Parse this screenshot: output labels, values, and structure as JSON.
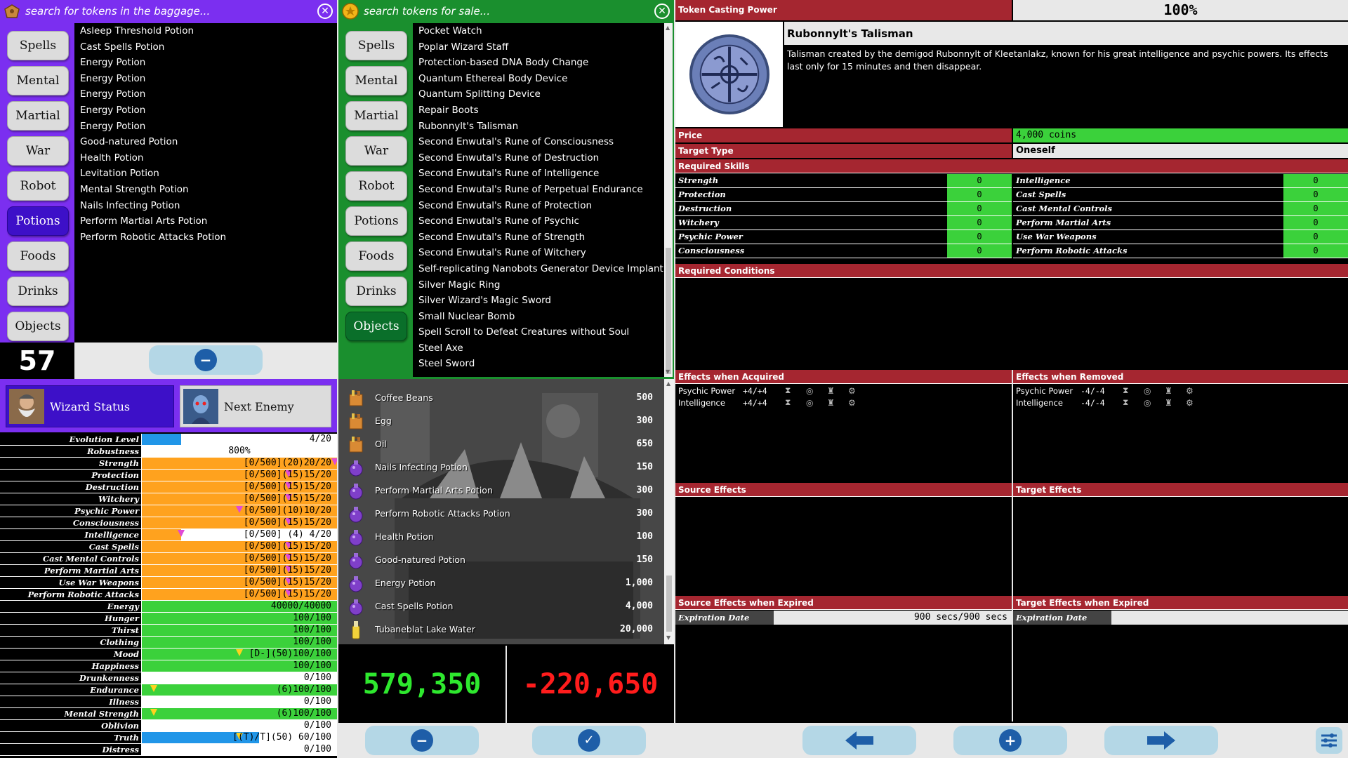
{
  "baggage": {
    "search_placeholder": "search for tokens in the baggage...",
    "categories": [
      "Spells",
      "Mental",
      "Martial",
      "War",
      "Robot",
      "Potions",
      "Foods",
      "Drinks",
      "Objects"
    ],
    "selected_category": "Potions",
    "items": [
      "Asleep Threshold Potion",
      "Cast Spells Potion",
      "Energy Potion",
      "Energy Potion",
      "Energy Potion",
      "Energy Potion",
      "Energy Potion",
      "Good-natured Potion",
      "Health Potion",
      "Levitation Potion",
      "Mental Strength Potion",
      "Nails Infecting Potion",
      "Perform Martial Arts Potion",
      "Perform Robotic Attacks Potion"
    ],
    "count": "57"
  },
  "shop": {
    "search_placeholder": "search tokens for sale...",
    "categories": [
      "Spells",
      "Mental",
      "Martial",
      "War",
      "Robot",
      "Potions",
      "Foods",
      "Drinks",
      "Objects"
    ],
    "selected_category": "Objects",
    "items": [
      "Pocket Watch",
      "Poplar Wizard Staff",
      "Protection-based DNA Body Change",
      "Quantum Ethereal Body Device",
      "Quantum Splitting Device",
      "Repair Boots",
      "Rubonnylt's Talisman",
      "Second Enwutal's Rune of Consciousness",
      "Second Enwutal's Rune of Destruction",
      "Second Enwutal's Rune of Intelligence",
      "Second Enwutal's Rune of Perpetual Endurance",
      "Second Enwutal's Rune of Protection",
      "Second Enwutal's Rune of Psychic",
      "Second Enwutal's Rune of Strength",
      "Second Enwutal's Rune of Witchery",
      "Self-replicating Nanobots Generator Device Implant",
      "Silver Magic Ring",
      "Silver Wizard's Magic Sword",
      "Small Nuclear Bomb",
      "Spell Scroll to Defeat Creatures without Soul",
      "Steel Axe",
      "Steel Sword"
    ]
  },
  "tabs": {
    "wizard": "Wizard Status",
    "enemy": "Next Enemy"
  },
  "stats": [
    {
      "label": "Evolution Level",
      "value": "4/20",
      "color": "#2196e8",
      "fill": 0.2,
      "style": "val"
    },
    {
      "label": "Robustness",
      "value": "800%",
      "color": "#ffffff",
      "fill": 0,
      "style": "mid"
    },
    {
      "label": "Strength",
      "value": "[0/500](20)20/20",
      "color": "#ffa21e",
      "fill": 1.0,
      "style": "val",
      "mark": 0.99
    },
    {
      "label": "Protection",
      "value": "[0/500](15)15/20",
      "color": "#ffa21e",
      "fill": 1.0,
      "style": "val",
      "mark": 0.75
    },
    {
      "label": "Destruction",
      "value": "[0/500](15)15/20",
      "color": "#ffa21e",
      "fill": 1.0,
      "style": "val",
      "mark": 0.75
    },
    {
      "label": "Witchery",
      "value": "[0/500](15)15/20",
      "color": "#ffa21e",
      "fill": 1.0,
      "style": "val",
      "mark": 0.75
    },
    {
      "label": "Psychic Power",
      "value": "[0/500](10)10/20",
      "color": "#ffa21e",
      "fill": 1.0,
      "style": "val",
      "mark": 0.5
    },
    {
      "label": "Consciousness",
      "value": "[0/500](15)15/20",
      "color": "#ffa21e",
      "fill": 1.0,
      "style": "val",
      "mark": 0.75
    },
    {
      "label": "Intelligence",
      "value": "[0/500] (4) 4/20",
      "color": "#ffa21e",
      "fill": 0.2,
      "style": "val",
      "mark": 0.2
    },
    {
      "label": "Cast Spells",
      "value": "[0/500](15)15/20",
      "color": "#ffa21e",
      "fill": 1.0,
      "style": "val",
      "mark": 0.75
    },
    {
      "label": "Cast Mental Controls",
      "value": "[0/500](15)15/20",
      "color": "#ffa21e",
      "fill": 1.0,
      "style": "val",
      "mark": 0.75
    },
    {
      "label": "Perform Martial Arts",
      "value": "[0/500](15)15/20",
      "color": "#ffa21e",
      "fill": 1.0,
      "style": "val",
      "mark": 0.75
    },
    {
      "label": "Use War Weapons",
      "value": "[0/500](15)15/20",
      "color": "#ffa21e",
      "fill": 1.0,
      "style": "val",
      "mark": 0.75
    },
    {
      "label": "Perform Robotic Attacks",
      "value": "[0/500](15)15/20",
      "color": "#ffa21e",
      "fill": 1.0,
      "style": "val",
      "mark": 0.75
    },
    {
      "label": "Energy",
      "value": "40000/40000",
      "color": "#3bd13b",
      "fill": 1.0,
      "style": "val"
    },
    {
      "label": "Hunger",
      "value": "100/100",
      "color": "#3bd13b",
      "fill": 1.0,
      "style": "val"
    },
    {
      "label": "Thirst",
      "value": "100/100",
      "color": "#3bd13b",
      "fill": 1.0,
      "style": "val"
    },
    {
      "label": "Clothing",
      "value": "100/100",
      "color": "#3bd13b",
      "fill": 1.0,
      "style": "val"
    },
    {
      "label": "Mood",
      "value": "[D-](50)100/100",
      "color": "#3bd13b",
      "fill": 1.0,
      "style": "val",
      "ymark": 0.5
    },
    {
      "label": "Happiness",
      "value": "100/100",
      "color": "#3bd13b",
      "fill": 1.0,
      "style": "val"
    },
    {
      "label": "Drunkenness",
      "value": "0/100",
      "color": "#ffffff",
      "fill": 0,
      "style": "val"
    },
    {
      "label": "Endurance",
      "value": "(6)100/100",
      "color": "#3bd13b",
      "fill": 1.0,
      "style": "val",
      "ymark": 0.06
    },
    {
      "label": "Illness",
      "value": "0/100",
      "color": "#ffffff",
      "fill": 0,
      "style": "val"
    },
    {
      "label": "Mental Strength",
      "value": "(6)100/100",
      "color": "#3bd13b",
      "fill": 1.0,
      "style": "val",
      "ymark": 0.06
    },
    {
      "label": "Oblivion",
      "value": "0/100",
      "color": "#ffffff",
      "fill": 0,
      "style": "val"
    },
    {
      "label": "Truth",
      "value": "[(T)/T](50) 60/100",
      "color": "#2196e8",
      "fill": 0.6,
      "style": "val",
      "ymark": 0.5
    },
    {
      "label": "Distress",
      "value": "0/100",
      "color": "#ffffff",
      "fill": 0,
      "style": "val"
    }
  ],
  "sale_list": [
    {
      "name": "Coffee Beans",
      "price": "500",
      "icon": "shopping-bag-icon"
    },
    {
      "name": "Egg",
      "price": "300",
      "icon": "shopping-bag-icon"
    },
    {
      "name": "Oil",
      "price": "650",
      "icon": "shopping-bag-icon"
    },
    {
      "name": "Nails Infecting Potion",
      "price": "150",
      "icon": "potion-icon"
    },
    {
      "name": "Perform Martial Arts Potion",
      "price": "300",
      "icon": "potion-icon"
    },
    {
      "name": "Perform Robotic Attacks Potion",
      "price": "300",
      "icon": "potion-icon"
    },
    {
      "name": "Health Potion",
      "price": "100",
      "icon": "potion-icon"
    },
    {
      "name": "Good-natured Potion",
      "price": "150",
      "icon": "potion-icon"
    },
    {
      "name": "Energy Potion",
      "price": "1,000",
      "icon": "potion-icon"
    },
    {
      "name": "Cast Spells Potion",
      "price": "4,000",
      "icon": "potion-icon"
    },
    {
      "name": "Tubaneblat Lake Water",
      "price": "20,000",
      "icon": "bottle-icon"
    }
  ],
  "money": {
    "balance": "579,350",
    "delta": "-220,650"
  },
  "detail": {
    "casting_power_label": "Token Casting Power",
    "casting_power_value": "100%",
    "title": "Rubonnylt's Talisman",
    "description": "Talisman created by the demigod Rubonnylt of Kleetanlakz, known for his great intelligence and psychic powers. Its effects last only for 15 minutes and then disappear.",
    "price_label": "Price",
    "price_value": "4,000 coins",
    "target_type_label": "Target Type",
    "target_type_value": "Oneself",
    "required_skills_label": "Required Skills",
    "skills_left": [
      {
        "name": "Strength",
        "value": "0"
      },
      {
        "name": "Protection",
        "value": "0"
      },
      {
        "name": "Destruction",
        "value": "0"
      },
      {
        "name": "Witchery",
        "value": "0"
      },
      {
        "name": "Psychic Power",
        "value": "0"
      },
      {
        "name": "Consciousness",
        "value": "0"
      }
    ],
    "skills_right": [
      {
        "name": "Intelligence",
        "value": "0"
      },
      {
        "name": "Cast Spells",
        "value": "0"
      },
      {
        "name": "Cast Mental Controls",
        "value": "0"
      },
      {
        "name": "Perform Martial Arts",
        "value": "0"
      },
      {
        "name": "Use War Weapons",
        "value": "0"
      },
      {
        "name": "Perform Robotic Attacks",
        "value": "0"
      }
    ],
    "required_conditions_label": "Required Conditions",
    "effects_acquired_label": "Effects when Acquired",
    "effects_removed_label": "Effects when Removed",
    "effects_acquired": [
      {
        "name": "Psychic Power",
        "value": "+4/+4"
      },
      {
        "name": "Intelligence",
        "value": "+4/+4"
      }
    ],
    "effects_removed": [
      {
        "name": "Psychic Power",
        "value": "-4/-4"
      },
      {
        "name": "Intelligence",
        "value": "-4/-4"
      }
    ],
    "source_effects_label": "Source Effects",
    "target_effects_label": "Target Effects",
    "source_expired_label": "Source Effects when Expired",
    "target_expired_label": "Target Effects when Expired",
    "expiration_label": "Expiration Date",
    "expiration_value": "900 secs/900 secs",
    "expiration_label_right": "Expiration Date"
  },
  "colors": {
    "purple": "#7b2ff0",
    "green": "#1a8f2e",
    "red": "#a52630",
    "accent_blue": "#1e5ea8"
  }
}
